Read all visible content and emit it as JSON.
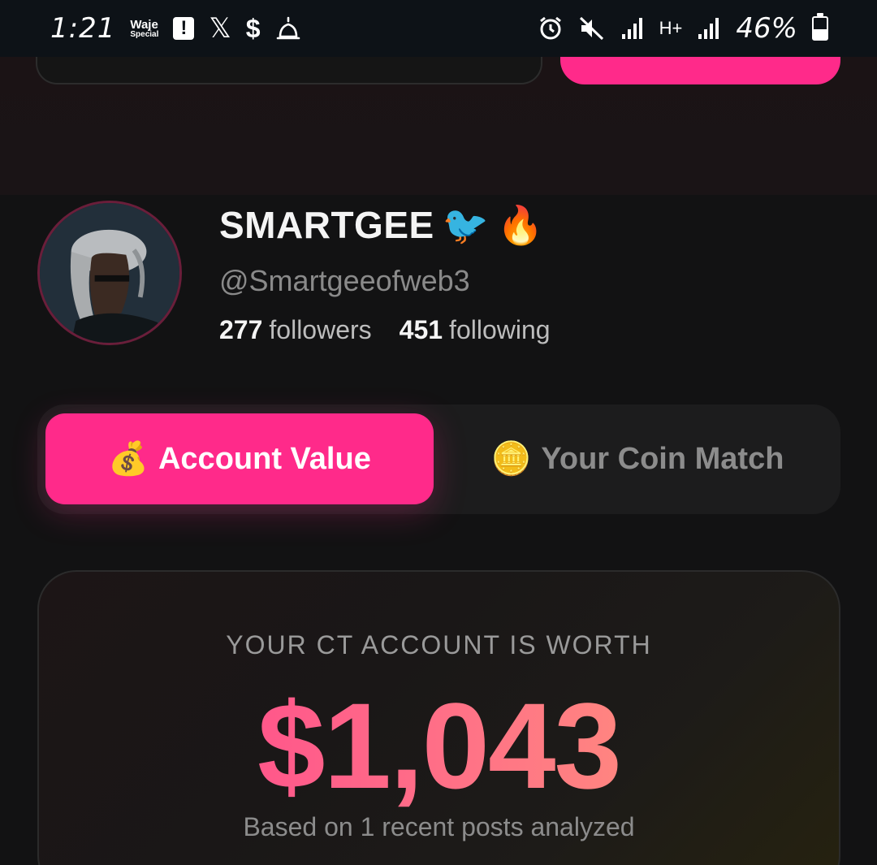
{
  "status_bar": {
    "time": "1:21",
    "waje_line1": "Waje",
    "waje_line2": "Special",
    "notification_icons": [
      "alert-icon",
      "x-logo-icon",
      "dollar-icon",
      "mosque-icon"
    ],
    "alert_glyph": "!",
    "x_glyph": "𝕏",
    "dollar_glyph": "$",
    "system_icons": [
      "alarm-icon",
      "mute-icon",
      "signal-icon",
      "data-icon",
      "signal-icon",
      "battery-icon"
    ],
    "data_glyph": "H+",
    "battery_percent": "46%",
    "battery_level": 0.46
  },
  "profile": {
    "display_name": "SMARTGEE",
    "name_emojis": [
      "🐦",
      "🔥"
    ],
    "handle": "@Smartgeeofweb3",
    "followers_count": "277",
    "followers_label": "followers",
    "following_count": "451",
    "following_label": "following"
  },
  "tabs": [
    {
      "emoji": "💰",
      "label": "Account Value",
      "active": true
    },
    {
      "emoji": "🪙",
      "label": "Your Coin Match",
      "active": false
    }
  ],
  "value_card": {
    "label": "YOUR CT ACCOUNT IS WORTH",
    "value": "$1,043",
    "subtext": "Based on 1 recent posts analyzed"
  },
  "colors": {
    "accent": "#ff2a8a",
    "background": "#121213",
    "card": "#1c1c1d",
    "value_gradient_start": "#ff3a8f",
    "value_gradient_end": "#ff9f78"
  }
}
